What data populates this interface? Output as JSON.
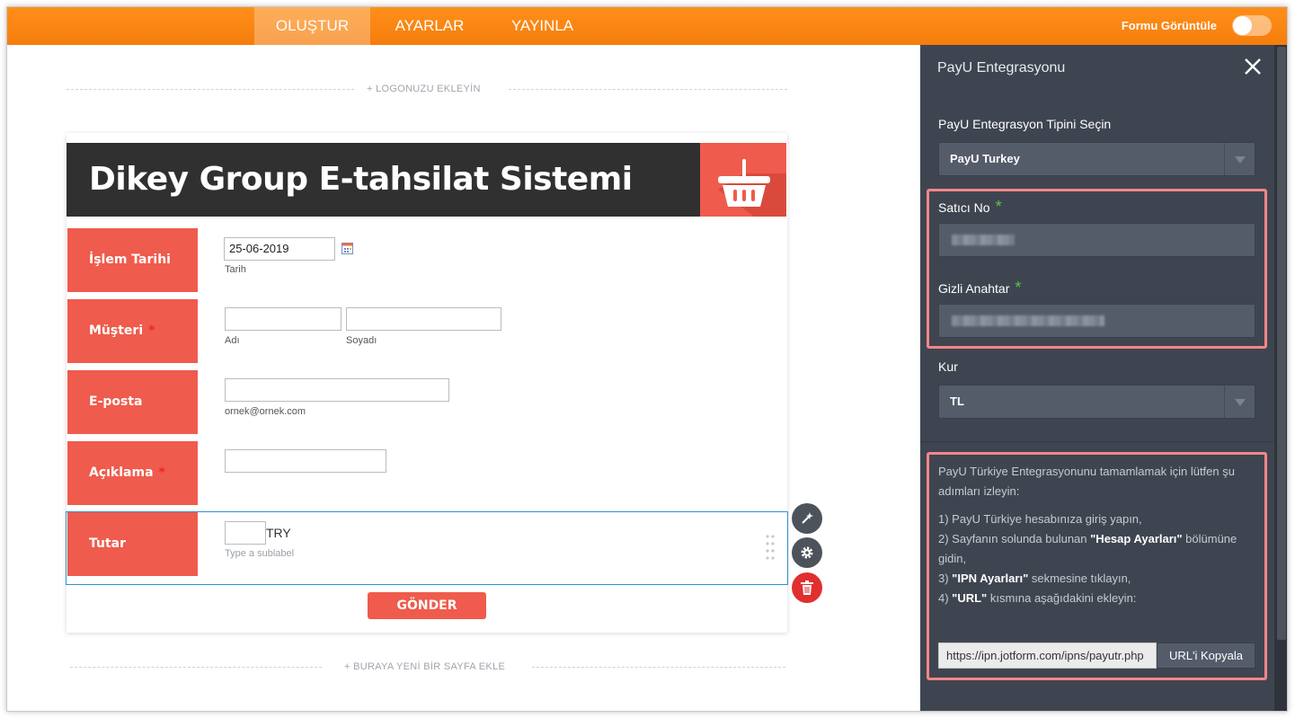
{
  "topbar": {
    "tabs": [
      {
        "label": "OLUŞTUR",
        "active": true
      },
      {
        "label": "AYARLAR",
        "active": false
      },
      {
        "label": "YAYINLA",
        "active": false
      }
    ],
    "preview_label": "Formu Görüntüle",
    "preview_on": false
  },
  "canvas": {
    "add_logo": "+ LOGONUZU EKLEYİN",
    "add_page": "+ BURAYA YENİ BİR SAYFA EKLE"
  },
  "form": {
    "title": "Dikey Group E-tahsilat Sistemi",
    "logo_icon": "shopping-basket-icon",
    "fields": {
      "date": {
        "label": "İşlem Tarihi",
        "value": "25-06-2019",
        "sublabel": "Tarih"
      },
      "customer": {
        "label": "Müşteri",
        "required": true,
        "first_sublabel": "Adı",
        "last_sublabel": "Soyadı"
      },
      "email": {
        "label": "E-posta",
        "sublabel": "ornek@ornek.com"
      },
      "description": {
        "label": "Açıklama",
        "required": true
      },
      "amount": {
        "label": "Tutar",
        "currency": "TRY",
        "sublabel": "Type a sublabel"
      }
    },
    "submit_label": "GÖNDER",
    "required_mark": "*"
  },
  "panel": {
    "title": "PayU Entegrasyonu",
    "type_label": "PayU Entegrasyon Tipini Seçin",
    "type_value": "PayU Turkey",
    "merchant_label": "Satıcı No",
    "secret_label": "Gizli Anahtar",
    "required_mark": "*",
    "currency_label": "Kur",
    "currency_value": "TL",
    "instructions": {
      "intro": "PayU Türkiye Entegrasyonunu tamamlamak için lütfen şu adımları izleyin:",
      "step1": "1) PayU Türkiye hesabınıza giriş yapın,",
      "step2_pre": "2) Sayfanın solunda bulunan ",
      "step2_bold": "\"Hesap Ayarları\"",
      "step2_post": " bölümüne gidin,",
      "step3_pre": "3) ",
      "step3_bold": "\"IPN Ayarları\"",
      "step3_post": " sekmesine tıklayın,",
      "step4_pre": "4) ",
      "step4_bold": "\"URL\"",
      "step4_post": " kısmına aşağıdakini ekleyin:"
    },
    "url_value": "https://ipn.jotform.com/ipns/payutr.php",
    "copy_button": "URL'i Kopyala"
  },
  "colors": {
    "topbar": "#f98612",
    "accent_red": "#ef5b4c",
    "panel_bg": "#3f4550",
    "highlight": "#f2868a",
    "required_star": "#59c44a"
  }
}
